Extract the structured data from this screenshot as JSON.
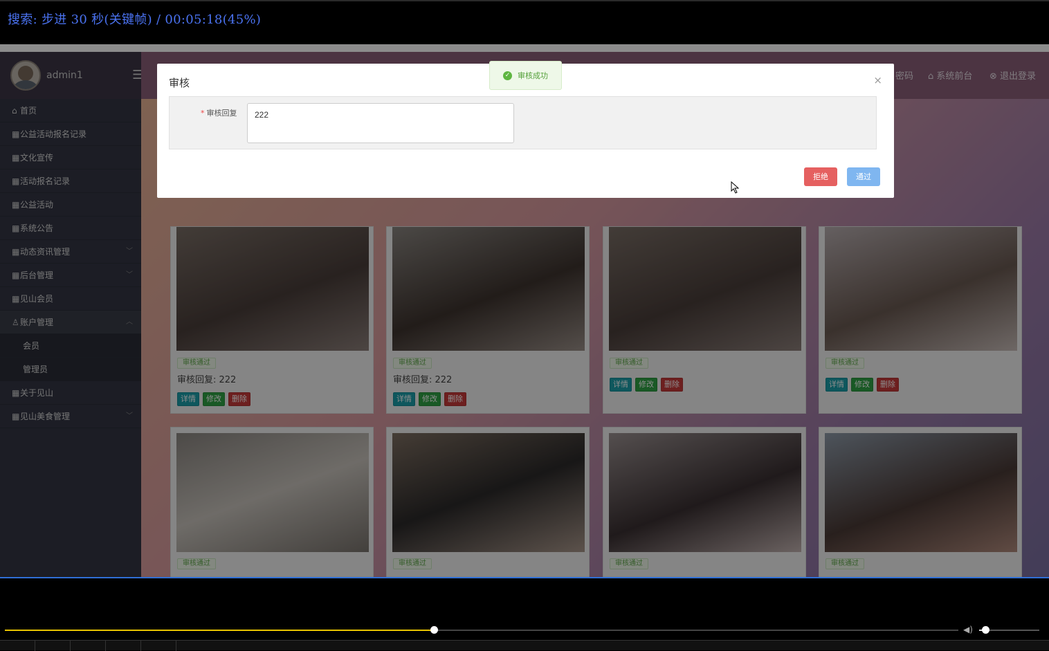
{
  "player": {
    "osd_text": "搜索: 步进 30 秒(关键帧) / 00:05:18(45%)",
    "progress": 0.45,
    "volume": 0.1,
    "toolbar_slots": 5
  },
  "sidebar": {
    "username": "admin1",
    "items": [
      {
        "label": "首页",
        "icon": "home-icon"
      },
      {
        "label": "公益活动报名记录",
        "icon": "grid-icon"
      },
      {
        "label": "文化宣传",
        "icon": "grid-icon"
      },
      {
        "label": "活动报名记录",
        "icon": "grid-icon"
      },
      {
        "label": "公益活动",
        "icon": "grid-icon"
      },
      {
        "label": "系统公告",
        "icon": "grid-icon"
      },
      {
        "label": "动态资讯管理",
        "icon": "grid-icon",
        "expandable": true
      },
      {
        "label": "后台管理",
        "icon": "grid-icon",
        "expandable": true
      },
      {
        "label": "见山会员",
        "icon": "grid-icon"
      },
      {
        "label": "账户管理",
        "icon": "user-icon",
        "expandable": true,
        "open": true
      },
      {
        "label": "会员",
        "sub": true
      },
      {
        "label": "管理员",
        "sub": true
      },
      {
        "label": "关于见山",
        "icon": "grid-icon"
      },
      {
        "label": "见山美食管理",
        "icon": "grid-icon",
        "expandable": true
      }
    ]
  },
  "header": {
    "change_password": "密码",
    "front_desk": "系统前台",
    "logout": "退出登录"
  },
  "cards": [
    {
      "status": "审核通过",
      "reply": "审核回复: 222"
    },
    {
      "status": "审核通过",
      "reply": "审核回复: 222"
    },
    {
      "status": "审核通过",
      "reply": ""
    },
    {
      "status": "审核通过",
      "reply": ""
    },
    {
      "status": "审核通过",
      "reply": ""
    },
    {
      "status": "审核通过",
      "reply": ""
    },
    {
      "status": "审核通过",
      "reply": ""
    },
    {
      "status": "审核通过",
      "reply": ""
    }
  ],
  "card_buttons": {
    "detail": "详情",
    "edit": "修改",
    "delete": "删除"
  },
  "dialog": {
    "title": "审核",
    "field_label": "审核回复",
    "field_value": "222",
    "reject": "拒绝",
    "pass": "通过",
    "close": "×"
  },
  "toast": {
    "text": "审核成功"
  },
  "colors": {
    "accent": "#4a72f0",
    "progress": "#e8c400",
    "success": "#5fb642",
    "reject": "#e56060",
    "pass": "#7fb6f0"
  }
}
